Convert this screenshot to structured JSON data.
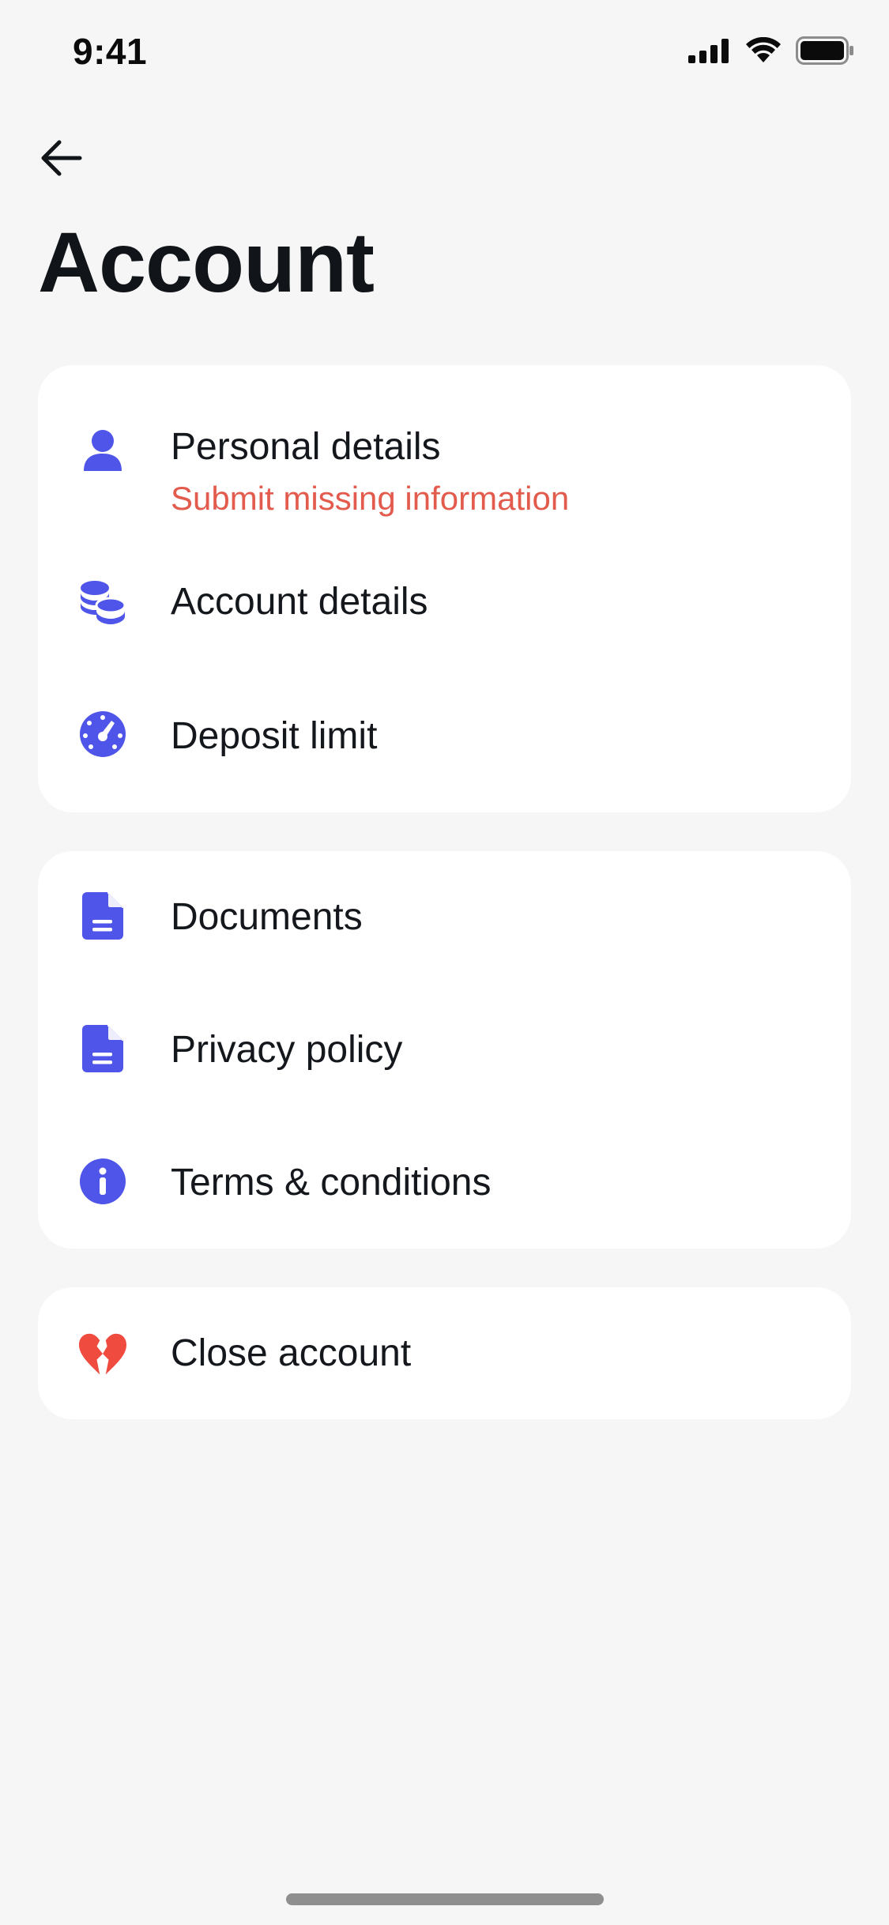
{
  "status_bar": {
    "time": "9:41",
    "icons": [
      "cellular-signal-icon",
      "wifi-icon",
      "battery-icon"
    ]
  },
  "header": {
    "back_icon": "arrow-left-icon",
    "title": "Account"
  },
  "colors": {
    "accent": "#4f55e8",
    "warning": "#e25b4d",
    "danger": "#ef4b3f",
    "background": "#f6f6f6",
    "card": "#ffffff"
  },
  "groups": [
    {
      "items": [
        {
          "icon": "person-icon",
          "label": "Personal details",
          "sublabel": "Submit missing information"
        },
        {
          "icon": "coins-icon",
          "label": "Account details"
        },
        {
          "icon": "gauge-icon",
          "label": "Deposit limit"
        }
      ]
    },
    {
      "items": [
        {
          "icon": "document-icon",
          "label": "Documents"
        },
        {
          "icon": "document-icon",
          "label": "Privacy policy"
        },
        {
          "icon": "info-icon",
          "label": "Terms & conditions"
        }
      ]
    },
    {
      "items": [
        {
          "icon": "broken-heart-icon",
          "label": "Close account"
        }
      ]
    }
  ]
}
